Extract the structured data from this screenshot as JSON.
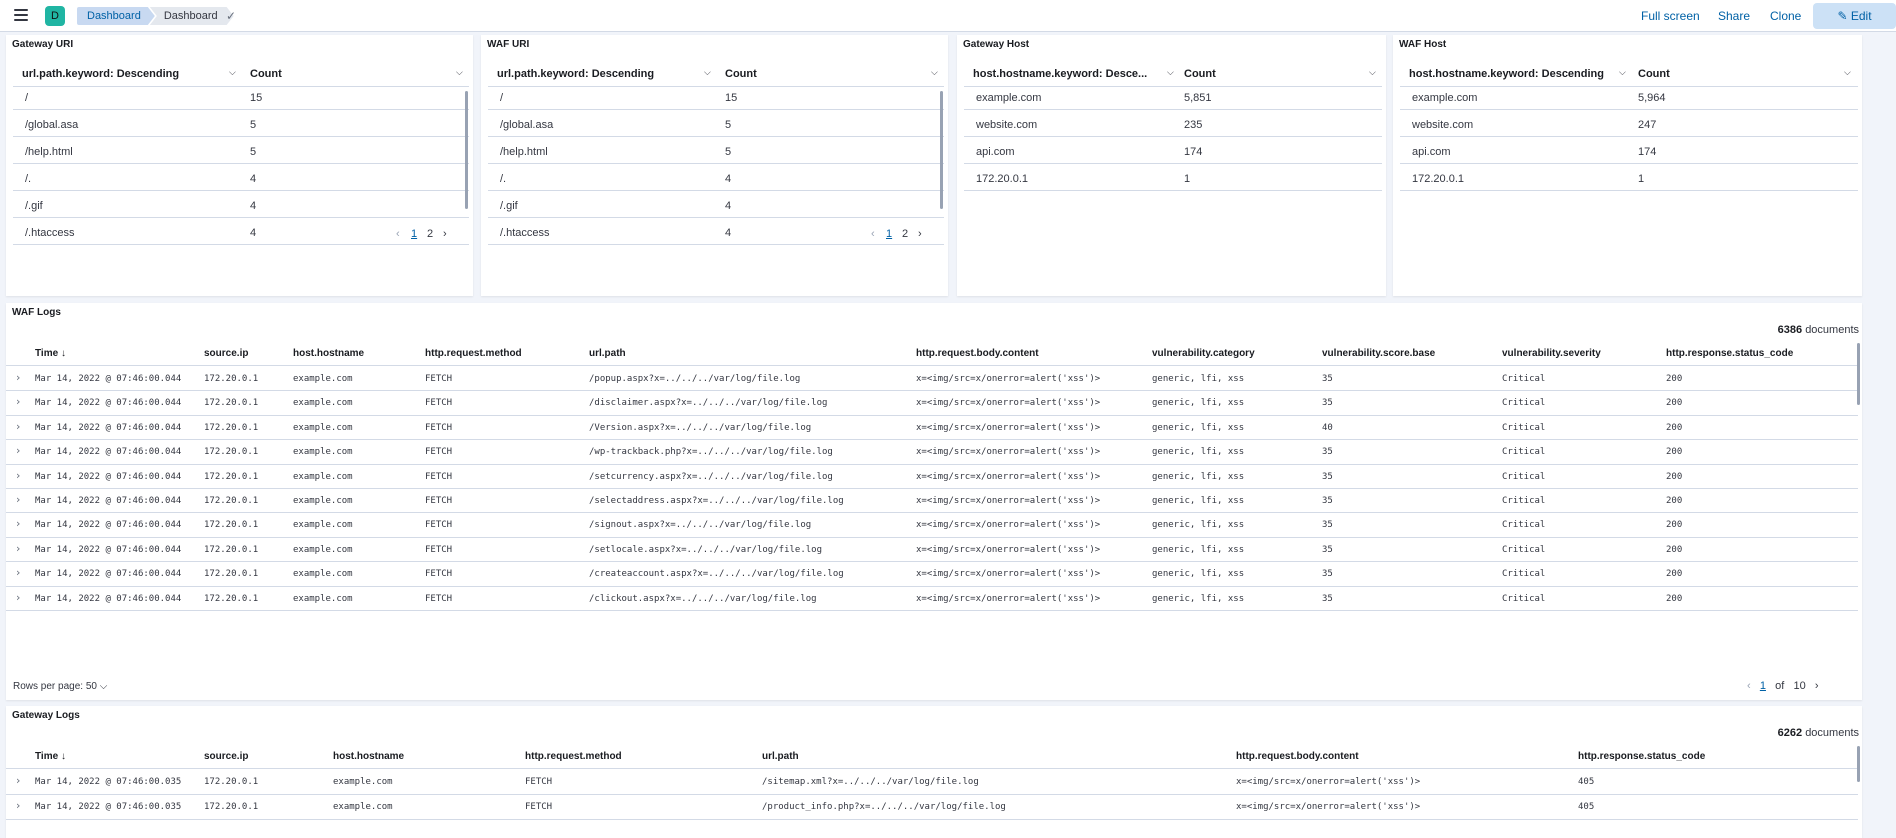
{
  "header": {
    "breadcrumbs": [
      "Dashboard",
      "Dashboard"
    ],
    "avatar": "D",
    "links": [
      "Full screen",
      "Share",
      "Clone"
    ],
    "edit_label": "Edit"
  },
  "panels": [
    {
      "title": "Gateway URI",
      "col1": "url.path.keyword: Descending",
      "col2": "Count",
      "rows": [
        [
          "/",
          "15"
        ],
        [
          "/global.asa",
          "5"
        ],
        [
          "/help.html",
          "5"
        ],
        [
          "/.",
          "4"
        ],
        [
          "/.gif",
          "4"
        ],
        [
          "/.htaccess",
          "4"
        ]
      ],
      "pages": [
        "1",
        "2"
      ]
    },
    {
      "title": "WAF URI",
      "col1": "url.path.keyword: Descending",
      "col2": "Count",
      "rows": [
        [
          "/",
          "15"
        ],
        [
          "/global.asa",
          "5"
        ],
        [
          "/help.html",
          "5"
        ],
        [
          "/.",
          "4"
        ],
        [
          "/.gif",
          "4"
        ],
        [
          "/.htaccess",
          "4"
        ]
      ],
      "pages": [
        "1",
        "2"
      ]
    },
    {
      "title": "Gateway Host",
      "col1": "host.hostname.keyword: Desce...",
      "col2": "Count",
      "rows": [
        [
          "example.com",
          "5,851"
        ],
        [
          "website.com",
          "235"
        ],
        [
          "api.com",
          "174"
        ],
        [
          "172.20.0.1",
          "1"
        ]
      ]
    },
    {
      "title": "WAF Host",
      "col1": "host.hostname.keyword: Descending",
      "col2": "Count",
      "rows": [
        [
          "example.com",
          "5,964"
        ],
        [
          "website.com",
          "247"
        ],
        [
          "api.com",
          "174"
        ],
        [
          "172.20.0.1",
          "1"
        ]
      ]
    }
  ],
  "waf_logs": {
    "title": "WAF Logs",
    "doc_count": "6386",
    "doc_label": "documents",
    "columns": [
      "Time",
      "source.ip",
      "host.hostname",
      "http.request.method",
      "url.path",
      "http.request.body.content",
      "vulnerability.category",
      "vulnerability.score.base",
      "vulnerability.severity",
      "http.response.status_code"
    ],
    "rows": [
      [
        "Mar 14, 2022 @ 07:46:00.044",
        "172.20.0.1",
        "example.com",
        "FETCH",
        "/popup.aspx?x=../../../var/log/file.log",
        "x=<img/src=x/onerror=alert('xss')>",
        "generic, lfi, xss",
        "35",
        "Critical",
        "200"
      ],
      [
        "Mar 14, 2022 @ 07:46:00.044",
        "172.20.0.1",
        "example.com",
        "FETCH",
        "/disclaimer.aspx?x=../../../var/log/file.log",
        "x=<img/src=x/onerror=alert('xss')>",
        "generic, lfi, xss",
        "35",
        "Critical",
        "200"
      ],
      [
        "Mar 14, 2022 @ 07:46:00.044",
        "172.20.0.1",
        "example.com",
        "FETCH",
        "/Version.aspx?x=../../../var/log/file.log",
        "x=<img/src=x/onerror=alert('xss')>",
        "generic, lfi, xss",
        "40",
        "Critical",
        "200"
      ],
      [
        "Mar 14, 2022 @ 07:46:00.044",
        "172.20.0.1",
        "example.com",
        "FETCH",
        "/wp-trackback.php?x=../../../var/log/file.log",
        "x=<img/src=x/onerror=alert('xss')>",
        "generic, lfi, xss",
        "35",
        "Critical",
        "200"
      ],
      [
        "Mar 14, 2022 @ 07:46:00.044",
        "172.20.0.1",
        "example.com",
        "FETCH",
        "/setcurrency.aspx?x=../../../var/log/file.log",
        "x=<img/src=x/onerror=alert('xss')>",
        "generic, lfi, xss",
        "35",
        "Critical",
        "200"
      ],
      [
        "Mar 14, 2022 @ 07:46:00.044",
        "172.20.0.1",
        "example.com",
        "FETCH",
        "/selectaddress.aspx?x=../../../var/log/file.log",
        "x=<img/src=x/onerror=alert('xss')>",
        "generic, lfi, xss",
        "35",
        "Critical",
        "200"
      ],
      [
        "Mar 14, 2022 @ 07:46:00.044",
        "172.20.0.1",
        "example.com",
        "FETCH",
        "/signout.aspx?x=../../../var/log/file.log",
        "x=<img/src=x/onerror=alert('xss')>",
        "generic, lfi, xss",
        "35",
        "Critical",
        "200"
      ],
      [
        "Mar 14, 2022 @ 07:46:00.044",
        "172.20.0.1",
        "example.com",
        "FETCH",
        "/setlocale.aspx?x=../../../var/log/file.log",
        "x=<img/src=x/onerror=alert('xss')>",
        "generic, lfi, xss",
        "35",
        "Critical",
        "200"
      ],
      [
        "Mar 14, 2022 @ 07:46:00.044",
        "172.20.0.1",
        "example.com",
        "FETCH",
        "/createaccount.aspx?x=../../../var/log/file.log",
        "x=<img/src=x/onerror=alert('xss')>",
        "generic, lfi, xss",
        "35",
        "Critical",
        "200"
      ],
      [
        "Mar 14, 2022 @ 07:46:00.044",
        "172.20.0.1",
        "example.com",
        "FETCH",
        "/clickout.aspx?x=../../../var/log/file.log",
        "x=<img/src=x/onerror=alert('xss')>",
        "generic, lfi, xss",
        "35",
        "Critical",
        "200"
      ]
    ],
    "rows_per_page": "Rows per page: 50",
    "page_current": "1",
    "page_of": "of",
    "page_total": "10"
  },
  "gateway_logs": {
    "title": "Gateway Logs",
    "doc_count": "6262",
    "doc_label": "documents",
    "columns": [
      "Time",
      "source.ip",
      "host.hostname",
      "http.request.method",
      "url.path",
      "http.request.body.content",
      "http.response.status_code"
    ],
    "rows": [
      [
        "Mar 14, 2022 @ 07:46:00.035",
        "172.20.0.1",
        "example.com",
        "FETCH",
        "/sitemap.xml?x=../../../var/log/file.log",
        "x=<img/src=x/onerror=alert('xss')>",
        "405"
      ],
      [
        "Mar 14, 2022 @ 07:46:00.035",
        "172.20.0.1",
        "example.com",
        "FETCH",
        "/product_info.php?x=../../../var/log/file.log",
        "x=<img/src=x/onerror=alert('xss')>",
        "405"
      ]
    ]
  },
  "colors": {
    "accent": "#0061a6",
    "avatar": "#20b5a3",
    "edit_bg": "#cce1f6",
    "page_bg": "#f1f4fa"
  }
}
